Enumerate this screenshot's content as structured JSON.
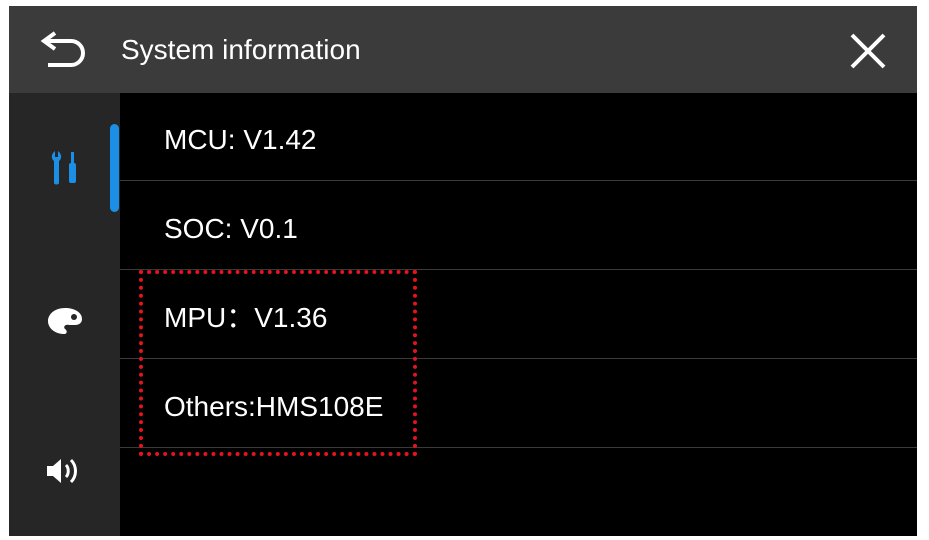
{
  "header": {
    "title": "System information",
    "back_icon": "back-arrow-icon",
    "close_icon": "close-icon"
  },
  "sidebar": {
    "active_index": 0,
    "items": [
      {
        "name": "settings-tools",
        "icon": "tools-icon"
      },
      {
        "name": "theme",
        "icon": "palette-icon"
      },
      {
        "name": "sound",
        "icon": "speaker-icon"
      }
    ]
  },
  "info_rows": [
    {
      "text": "MCU: V1.42"
    },
    {
      "text": "SOC: V0.1"
    },
    {
      "text": "MPU：V1.36"
    },
    {
      "text": "Others:HMS108E"
    }
  ],
  "colors": {
    "accent": "#1b8fe6",
    "header_bg": "#3b3b3b",
    "sidebar_bg": "#262626",
    "content_bg": "#000000",
    "highlight": "#e3141c"
  }
}
